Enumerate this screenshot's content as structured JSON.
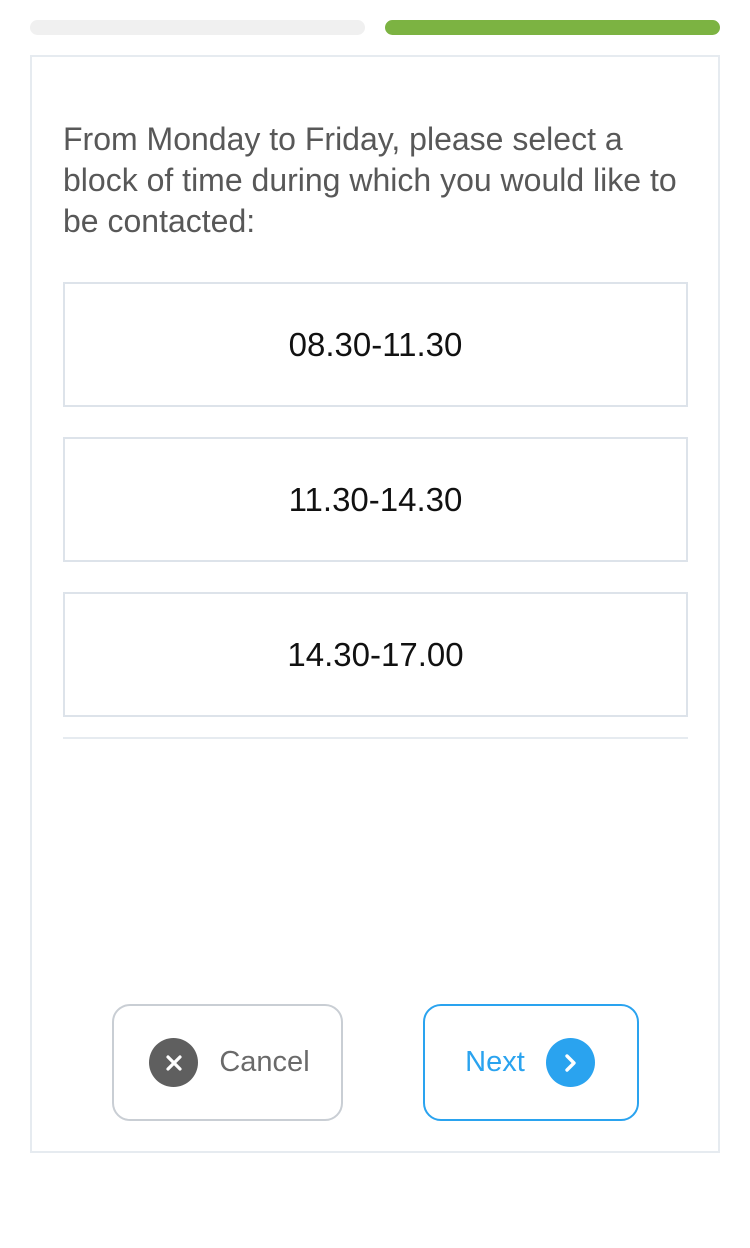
{
  "progress": {
    "steps_total": 2,
    "current_step": 2,
    "inactive_color": "#f0f0f0",
    "active_color": "#7cb342"
  },
  "question": {
    "text": "From Monday to Friday, please select a block of time during which you would like to be contacted:"
  },
  "options": [
    {
      "label": "08.30-11.30"
    },
    {
      "label": "11.30-14.30"
    },
    {
      "label": "14.30-17.00"
    }
  ],
  "actions": {
    "cancel": {
      "label": "Cancel",
      "icon": "close-icon"
    },
    "next": {
      "label": "Next",
      "icon": "chevron-right-icon"
    }
  },
  "colors": {
    "accent": "#2aa3ef",
    "progress_active": "#7cb342",
    "text": "#585858"
  }
}
